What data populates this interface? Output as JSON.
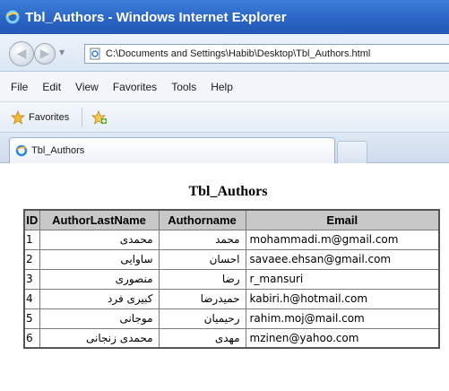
{
  "window": {
    "title": "Tbl_Authors - Windows Internet Explorer"
  },
  "address": {
    "url": "C:\\Documents and Settings\\Habib\\Desktop\\Tbl_Authors.html"
  },
  "menu": {
    "items": [
      "File",
      "Edit",
      "View",
      "Favorites",
      "Tools",
      "Help"
    ]
  },
  "favorites": {
    "label": "Favorites"
  },
  "tab": {
    "title": "Tbl_Authors"
  },
  "table": {
    "caption": "Tbl_Authors",
    "headers": [
      "ID",
      "AuthorLastName",
      "Authorname",
      "Email"
    ],
    "rows": [
      {
        "id": "1",
        "last": "محمدی",
        "first": "محمد",
        "email": "mohammadi.m@gmail.com"
      },
      {
        "id": "2",
        "last": "ساوایی",
        "first": "احسان",
        "email": "savaee.ehsan@gmail.com"
      },
      {
        "id": "3",
        "last": "منصوری",
        "first": "رضا",
        "email": "r_mansuri"
      },
      {
        "id": "4",
        "last": "کبیری فرد",
        "first": "حمیدرضا",
        "email": "kabiri.h@hotmail.com"
      },
      {
        "id": "5",
        "last": "موجانی",
        "first": "رحیمیان",
        "email": "rahim.moj@mail.com"
      },
      {
        "id": "6",
        "last": "محمدی زنجانی",
        "first": "مهدی",
        "email": "mzinen@yahoo.com"
      }
    ]
  },
  "colors": {
    "titlebar": "#2a63c4",
    "header_bg": "#c8c8c8"
  },
  "icons": [
    "ie-logo-icon",
    "back-arrow-icon",
    "forward-arrow-icon",
    "page-icon",
    "favorites-star-icon",
    "add-favorites-icon",
    "tab-ie-icon"
  ]
}
